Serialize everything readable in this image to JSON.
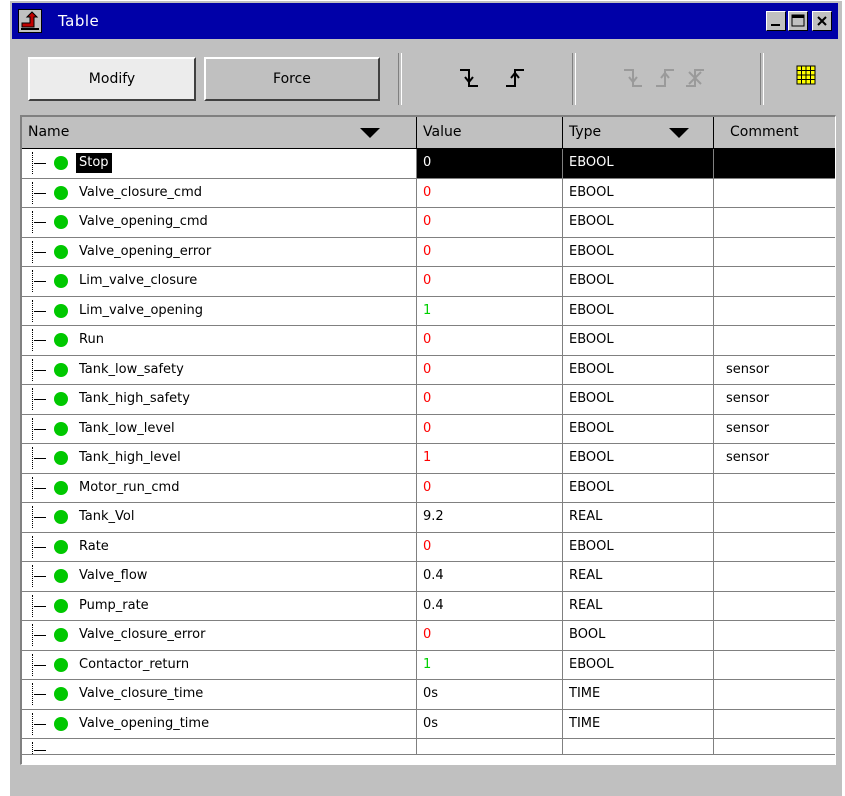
{
  "window": {
    "title": "Table"
  },
  "toolbar": {
    "modify_label": "Modify",
    "force_label": "Force"
  },
  "columns": {
    "name": "Name",
    "value": "Value",
    "type": "Type",
    "comment": "Comment"
  },
  "rows": [
    {
      "name": "Stop",
      "value": "0",
      "type": "EBOOL",
      "comment": "",
      "value_color": "#ffffff",
      "selected": true
    },
    {
      "name": "Valve_closure_cmd",
      "value": "0",
      "type": "EBOOL",
      "comment": "",
      "value_color": "#ff0000"
    },
    {
      "name": "Valve_opening_cmd",
      "value": "0",
      "type": "EBOOL",
      "comment": "",
      "value_color": "#ff0000"
    },
    {
      "name": "Valve_opening_error",
      "value": "0",
      "type": "EBOOL",
      "comment": "",
      "value_color": "#ff0000"
    },
    {
      "name": "Lim_valve_closure",
      "value": "0",
      "type": "EBOOL",
      "comment": "",
      "value_color": "#ff0000"
    },
    {
      "name": "Lim_valve_opening",
      "value": "1",
      "type": "EBOOL",
      "comment": "",
      "value_color": "#00d000"
    },
    {
      "name": "Run",
      "value": "0",
      "type": "EBOOL",
      "comment": "",
      "value_color": "#ff0000"
    },
    {
      "name": "Tank_low_safety",
      "value": "0",
      "type": "EBOOL",
      "comment": "sensor",
      "value_color": "#ff0000"
    },
    {
      "name": "Tank_high_safety",
      "value": "0",
      "type": "EBOOL",
      "comment": "sensor",
      "value_color": "#ff0000"
    },
    {
      "name": "Tank_low_level",
      "value": "0",
      "type": "EBOOL",
      "comment": "sensor",
      "value_color": "#ff0000"
    },
    {
      "name": "Tank_high_level",
      "value": "1",
      "type": "EBOOL",
      "comment": "sensor",
      "value_color": "#ff0000"
    },
    {
      "name": "Motor_run_cmd",
      "value": "0",
      "type": "EBOOL",
      "comment": "",
      "value_color": "#ff0000"
    },
    {
      "name": "Tank_Vol",
      "value": "9.2",
      "type": "REAL",
      "comment": "",
      "value_color": "#000000"
    },
    {
      "name": "Rate",
      "value": "0",
      "type": "EBOOL",
      "comment": "",
      "value_color": "#ff0000"
    },
    {
      "name": "Valve_flow",
      "value": "0.4",
      "type": "REAL",
      "comment": "",
      "value_color": "#000000"
    },
    {
      "name": "Pump_rate",
      "value": "0.4",
      "type": "REAL",
      "comment": "",
      "value_color": "#000000"
    },
    {
      "name": "Valve_closure_error",
      "value": "0",
      "type": "BOOL",
      "comment": "",
      "value_color": "#ff0000"
    },
    {
      "name": "Contactor_return",
      "value": "1",
      "type": "EBOOL",
      "comment": "",
      "value_color": "#00d000"
    },
    {
      "name": "Valve_closure_time",
      "value": "0s",
      "type": "TIME",
      "comment": "",
      "value_color": "#000000"
    },
    {
      "name": "Valve_opening_time",
      "value": "0s",
      "type": "TIME",
      "comment": "",
      "value_color": "#000000"
    }
  ]
}
